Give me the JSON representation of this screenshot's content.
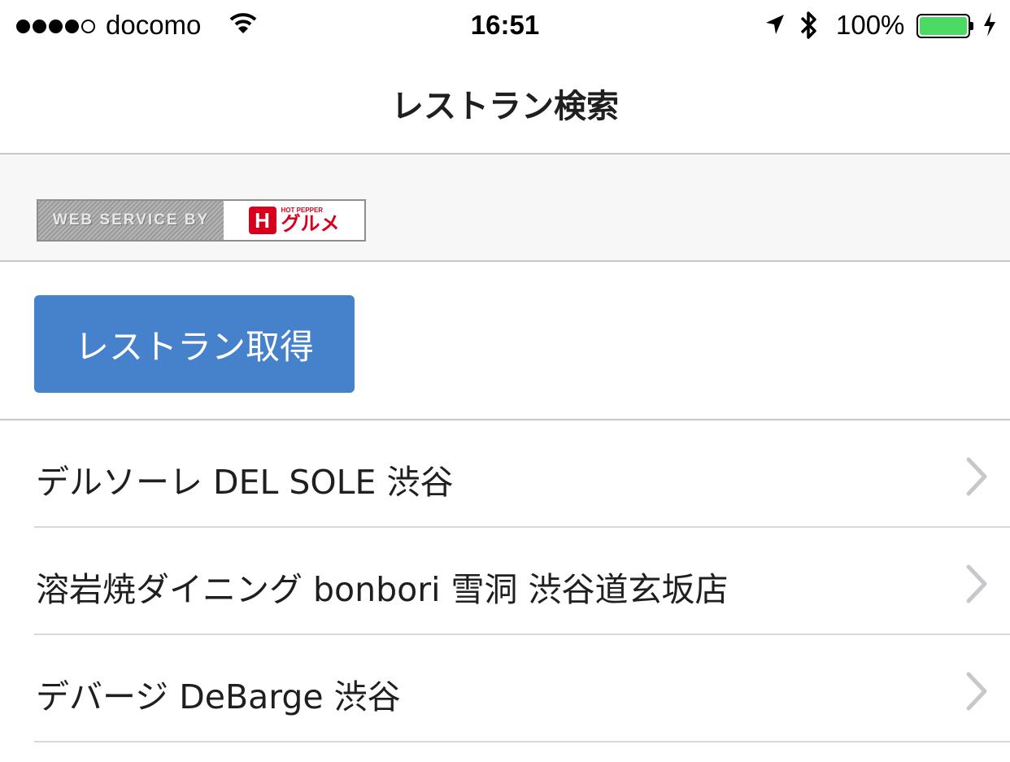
{
  "status_bar": {
    "carrier": "docomo",
    "time": "16:51",
    "battery_percent": "100%",
    "battery_level": 1.0,
    "signal_bars": 4,
    "signal_total": 5
  },
  "nav": {
    "title": "レストラン検索"
  },
  "banner": {
    "credit_text": "WEB SERVICE BY",
    "brand_small": "HOT PEPPER",
    "brand_name": "グルメ",
    "brand_icon_letter": "H",
    "brand_color": "#d6001c"
  },
  "action": {
    "fetch_button_label": "レストラン取得",
    "button_color": "#4682cc"
  },
  "restaurants": [
    {
      "name": "デルソーレ DEL SOLE 渋谷"
    },
    {
      "name": "溶岩焼ダイニング bonbori 雪洞 渋谷道玄坂店"
    },
    {
      "name": "デバージ DeBarge 渋谷"
    }
  ],
  "icons": {
    "wifi": "wifi-icon",
    "location": "location-arrow-icon",
    "bluetooth": "bluetooth-icon",
    "charging": "charging-bolt-icon",
    "disclosure": "chevron-right-icon"
  }
}
